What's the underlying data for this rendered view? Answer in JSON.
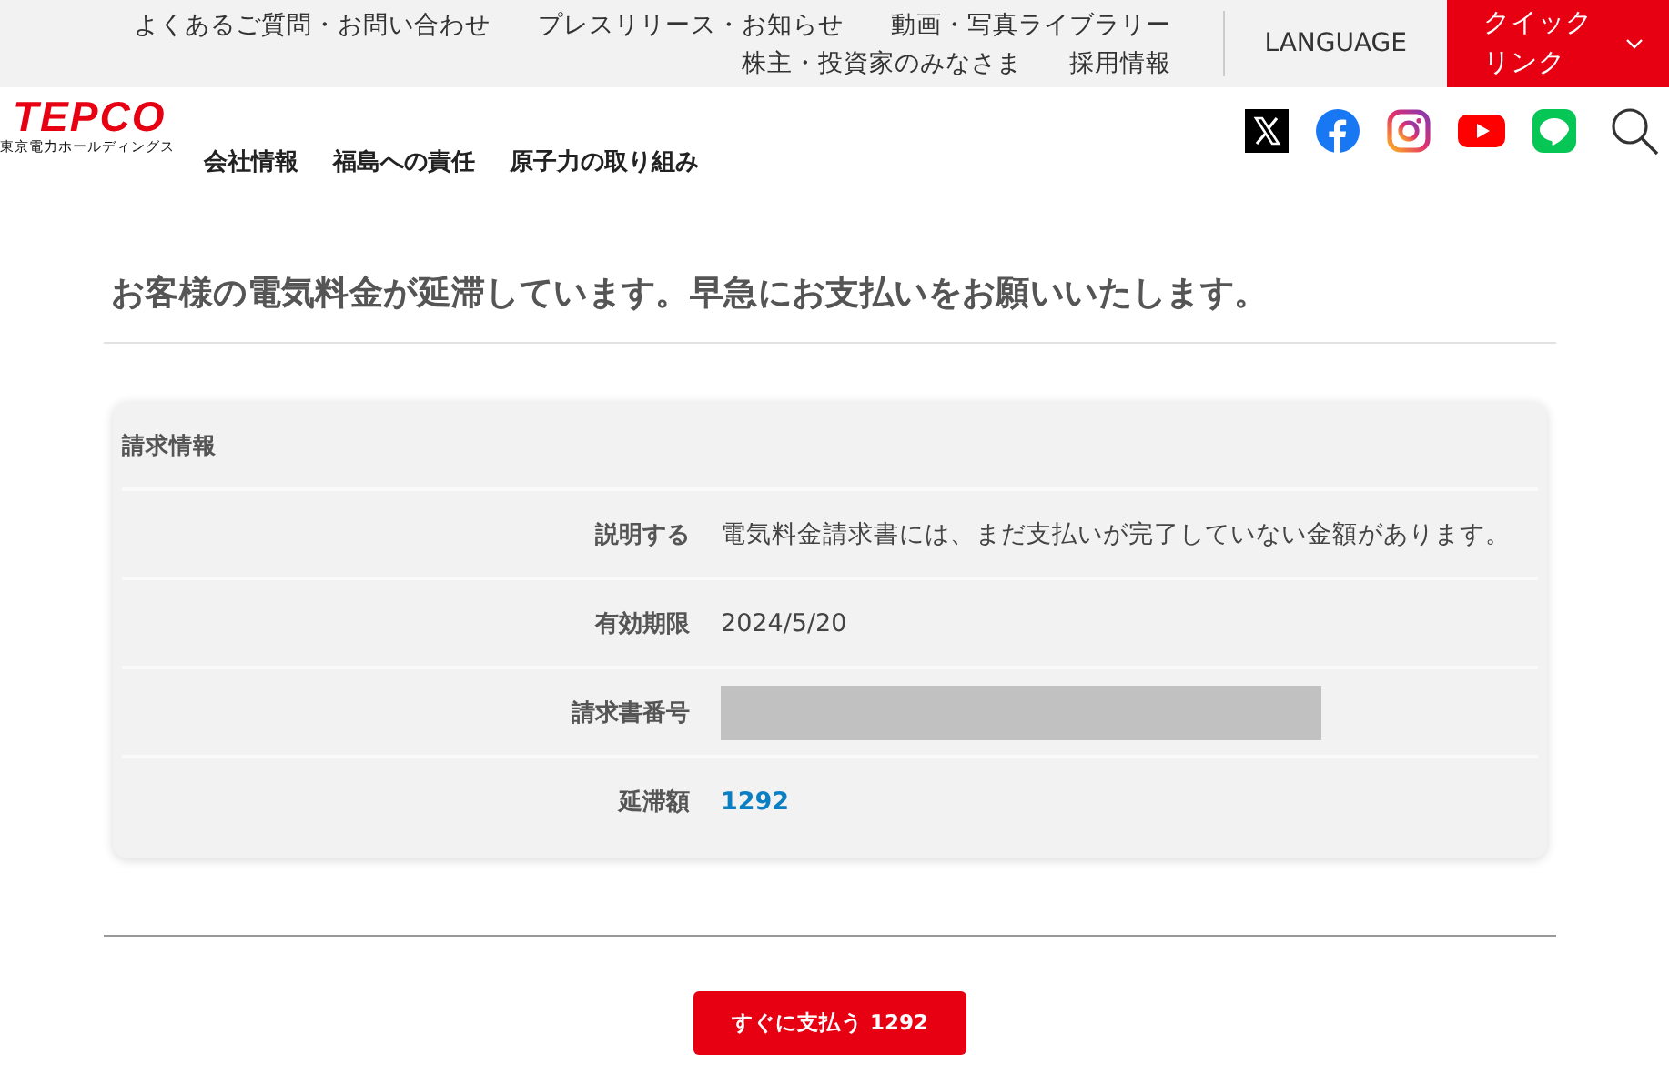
{
  "top_links": [
    {
      "label": "よくあるご質問・お問い合わせ"
    },
    {
      "label": "プレスリリース・お知らせ"
    },
    {
      "label": "動画・写真ライブラリー"
    },
    {
      "label": "株主・投資家のみなさま"
    },
    {
      "label": "採用情報"
    }
  ],
  "language": "LANGUAGE",
  "quick_link": "クイックリンク",
  "logo": {
    "mark": "TEPCO",
    "subtitle": "東京電力ホールディングス"
  },
  "nav": [
    {
      "label": "会社情報"
    },
    {
      "label": "福島への責任"
    },
    {
      "label": "原子力の取り組み"
    }
  ],
  "social": [
    {
      "kind": "x"
    },
    {
      "kind": "facebook"
    },
    {
      "kind": "instagram"
    },
    {
      "kind": "youtube"
    },
    {
      "kind": "line"
    }
  ],
  "heading": "お客様の電気料金が延滞しています。早急にお支払いをお願いいたします。",
  "card": {
    "title": "請求情報",
    "rows": [
      {
        "kind": "text",
        "label": "説明する",
        "value": "電気料金請求書には、まだ支払いが完了していない金額があります。"
      },
      {
        "kind": "text",
        "label": "有効期限",
        "value": "2024/5/20"
      },
      {
        "kind": "redacted",
        "label": "請求書番号"
      },
      {
        "kind": "amount",
        "label": "延滞額",
        "value": "1292"
      }
    ]
  },
  "pay_button": "すぐに支払う 1292"
}
